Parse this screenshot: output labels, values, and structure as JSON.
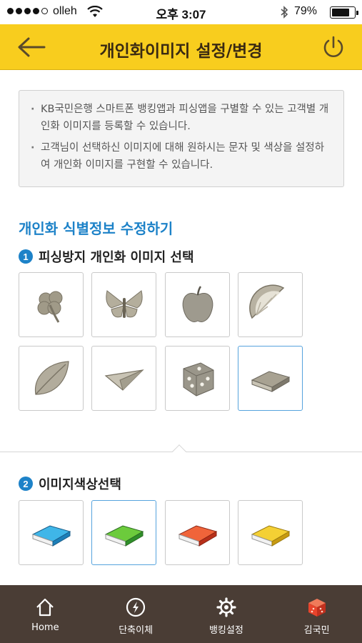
{
  "status_bar": {
    "carrier": "olleh",
    "time": "오후 3:07",
    "battery": "79%",
    "battery_level": 0.79
  },
  "header": {
    "title": "개인화이미지 설정/변경",
    "back_icon": "back-arrow-icon",
    "power_icon": "power-icon"
  },
  "notice": [
    "KB국민은행 스마트폰 뱅킹앱과 피싱앱을 구별할 수 있는 고객별 개인화 이미지를 등록할 수 있습니다.",
    "고객님이 선택하신 이미지에 대해 원하시는 문자 및 색상을 설정하여 개인화 이미지를 구현할 수 있습니다."
  ],
  "section_title": "개인화 식별정보 수정하기",
  "step1": {
    "number": "1",
    "label": "피싱방지 개인화 이미지 선택",
    "images": [
      "clover",
      "butterfly",
      "apple",
      "lemon",
      "leaf",
      "paper-plane",
      "dice",
      "book"
    ],
    "selected": "book"
  },
  "step2": {
    "number": "2",
    "label": "이미지색상선택",
    "colors": [
      {
        "name": "blue",
        "top": "#3fb6e8",
        "side": "#1c7fb8"
      },
      {
        "name": "green",
        "top": "#6ccb3c",
        "side": "#2f8f2a"
      },
      {
        "name": "red",
        "top": "#f0643a",
        "side": "#b8301a"
      },
      {
        "name": "yellow",
        "top": "#f4d034",
        "side": "#c79a10"
      }
    ],
    "selected": "green"
  },
  "bottom_nav": [
    {
      "label": "Home",
      "icon": "home-icon"
    },
    {
      "label": "단축이체",
      "icon": "lightning-icon"
    },
    {
      "label": "뱅킹설정",
      "icon": "gear-icon"
    },
    {
      "label": "김국민",
      "icon": "profile-cube-icon"
    }
  ],
  "colors": {
    "header": "#f8cd1e",
    "accent": "#1d82c8",
    "nav": "#4a3d35"
  }
}
